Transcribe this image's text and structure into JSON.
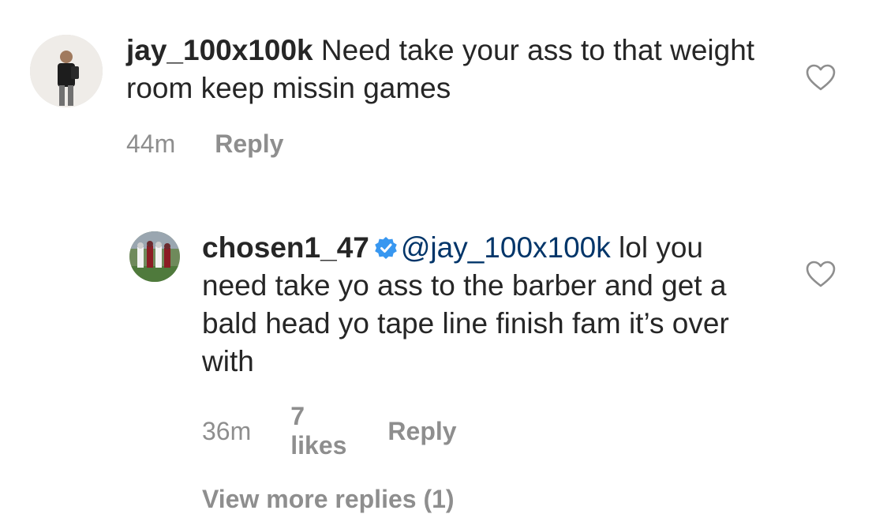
{
  "comments": [
    {
      "username": "jay_100x100k",
      "text": "Need take your ass to that weight room keep missin games",
      "time": "44m",
      "reply_label": "Reply"
    }
  ],
  "replies": [
    {
      "username": "chosen1_47",
      "verified": true,
      "mention": "@jay_100x100k",
      "text": "lol you need take yo ass to the barber and get a bald head yo tape line finish fam it’s over with",
      "time": "36m",
      "likes": "7 likes",
      "reply_label": "Reply"
    }
  ],
  "view_more": "View more replies (1)",
  "colors": {
    "text": "#262626",
    "meta": "#8e8e8e",
    "mention": "#003569",
    "verified": "#3897f0"
  },
  "icons": {
    "like": "heart-outline-icon",
    "verified": "verified-badge-icon"
  }
}
